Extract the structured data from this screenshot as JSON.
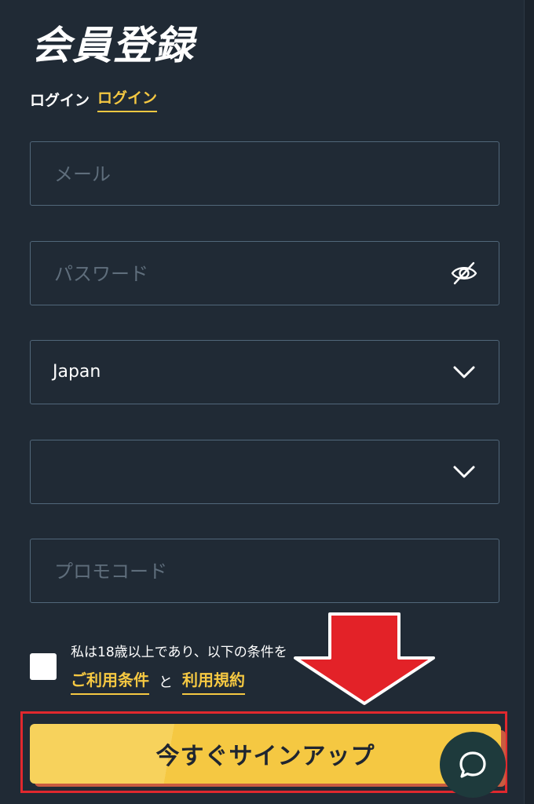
{
  "page": {
    "title": "会員登録"
  },
  "login": {
    "prefix": "ログイン",
    "link": "ログイン"
  },
  "form": {
    "email": {
      "placeholder": "メール",
      "value": ""
    },
    "password": {
      "placeholder": "パスワード",
      "value": "",
      "toggle_icon": "eye-slash-icon"
    },
    "country": {
      "selected": "Japan",
      "icon": "chevron-down-icon"
    },
    "region": {
      "selected": "",
      "icon": "chevron-down-icon"
    },
    "promo": {
      "placeholder": "プロモコード",
      "value": ""
    }
  },
  "consent": {
    "text": "私は18歳以上であり、以下の条件を",
    "terms_link": "ご利用条件",
    "and": "と",
    "rules_link": "利用規約",
    "checked": false
  },
  "signup": {
    "label": "今すぐサインアップ"
  },
  "chat": {
    "icon": "chat-bubble-icon"
  },
  "colors": {
    "background": "#202a35",
    "accent": "#f5c842",
    "field_border": "#51677a",
    "highlight": "#e0282e"
  }
}
